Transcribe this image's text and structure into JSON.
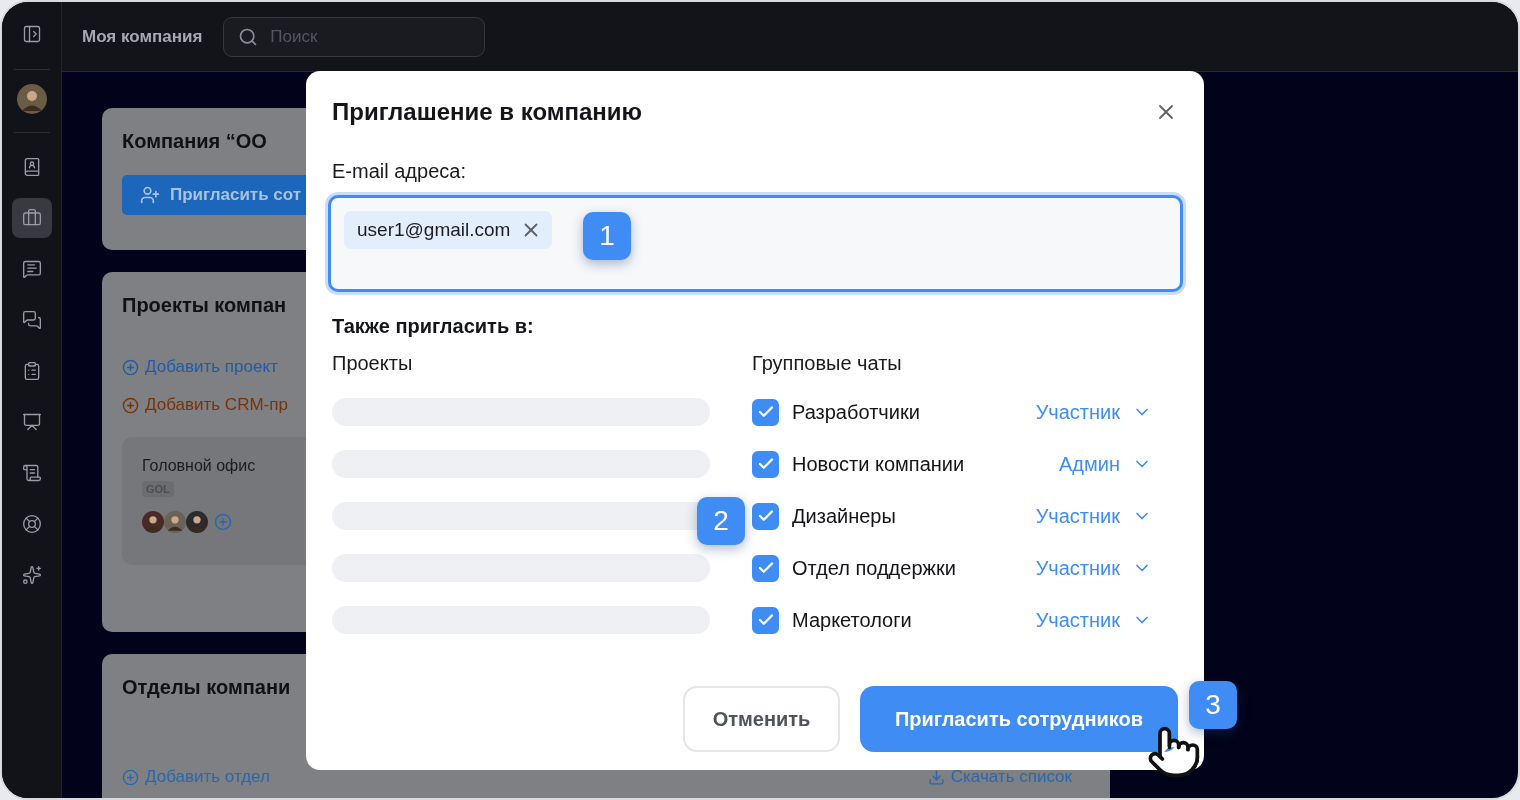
{
  "sidebar": {
    "items": [
      {
        "selected": false
      },
      {
        "selected": false
      },
      {
        "selected": true
      },
      {
        "selected": false
      },
      {
        "selected": false
      },
      {
        "selected": false
      },
      {
        "selected": false
      },
      {
        "selected": false
      },
      {
        "selected": false
      },
      {
        "selected": false
      }
    ]
  },
  "topbar": {
    "title": "Моя компания",
    "search": {
      "placeholder": "Поиск"
    }
  },
  "company_card": {
    "title": "Компания “ОО",
    "invite_button": "Пригласить сот"
  },
  "projects_card": {
    "title": "Проекты компан",
    "links": [
      {
        "label": "Добавить проект",
        "kind": "project"
      },
      {
        "label": "Добавить CRM-пр",
        "kind": "crm"
      }
    ],
    "project": {
      "name": "Головной офис",
      "code": "GOL"
    }
  },
  "departments_card": {
    "title": "Отделы компани",
    "add_link": "Добавить отдел",
    "download_link": "Скачать список"
  },
  "dialog": {
    "title": "Приглашение в компанию",
    "email_label": "E-mail адреса:",
    "emails": [
      "user1@gmail.com"
    ],
    "also_label": "Также пригласить в:",
    "projects_heading": "Проекты",
    "project_rows": [
      {
        "kind": "skeleton"
      },
      {
        "kind": "skeleton"
      },
      {
        "kind": "skeleton"
      },
      {
        "kind": "skeleton"
      },
      {
        "kind": "skeleton"
      }
    ],
    "chats_heading": "Групповые чаты",
    "chats": [
      {
        "name": "Разработчики",
        "checked": true,
        "role": "Участник"
      },
      {
        "name": "Новости компании",
        "checked": true,
        "role": "Админ"
      },
      {
        "name": "Дизайнеры",
        "checked": true,
        "role": "Участник"
      },
      {
        "name": "Отдел поддержки",
        "checked": true,
        "role": "Участник"
      },
      {
        "name": "Маркетологи",
        "checked": true,
        "role": "Участник"
      }
    ],
    "cancel_button": "Отменить",
    "submit_button": "Пригласить сотрудников"
  },
  "step_markers": [
    {
      "label": "1"
    },
    {
      "label": "2"
    },
    {
      "label": "3"
    }
  ]
}
